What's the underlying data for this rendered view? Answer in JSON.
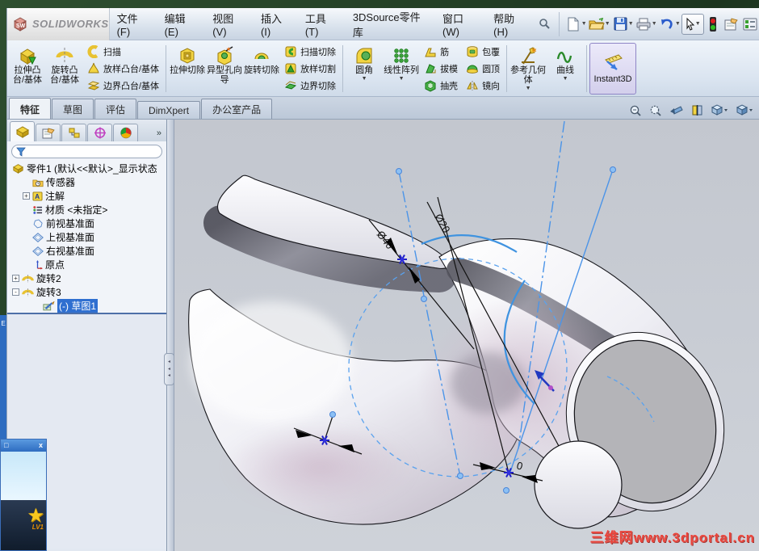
{
  "colors": {
    "selection": "#2f6fd0",
    "sketch_blue": "#4b94e8",
    "watermark_red": "#e8433a",
    "ribbon_bg": "#dae4f0"
  },
  "logo": {
    "text": "SOLIDWORKS"
  },
  "menu": {
    "items": [
      "文件(F)",
      "编辑(E)",
      "视图(V)",
      "插入(I)",
      "工具(T)",
      "3DSource零件库",
      "窗口(W)",
      "帮助(H)"
    ]
  },
  "ribbon": {
    "groups": [
      {
        "big": [
          "拉伸凸台/基体",
          "旋转凸台/基体"
        ],
        "small": [
          "扫描",
          "放样凸台/基体",
          "边界凸台/基体"
        ]
      },
      {
        "big": [
          "拉伸切除",
          "异型孔向导",
          "旋转切除"
        ],
        "small": [
          "扫描切除",
          "放样切割",
          "边界切除"
        ]
      },
      {
        "big": [
          "圆角",
          "线性阵列"
        ],
        "small": [
          "筋",
          "拔模",
          "抽壳"
        ],
        "small2": [
          "包覆",
          "圆顶",
          "镜向"
        ]
      },
      {
        "big": [
          "参考几何体",
          "曲线"
        ]
      },
      {
        "big": [
          "Instant3D"
        ]
      }
    ]
  },
  "tabs": {
    "items": [
      "特征",
      "草图",
      "评估",
      "DimXpert",
      "办公室产品"
    ],
    "active": "特征"
  },
  "feature_tree": {
    "title": "零件1  (默认<<默认>_显示状态",
    "items": [
      {
        "label": "传感器"
      },
      {
        "label": "注解",
        "expand": "+"
      },
      {
        "label": "材质 <未指定>"
      },
      {
        "label": "前视基准面"
      },
      {
        "label": "上视基准面"
      },
      {
        "label": "右视基准面"
      },
      {
        "label": "原点"
      },
      {
        "label": "旋转2",
        "expand": "+"
      },
      {
        "label": "旋转3",
        "expand": "-"
      },
      {
        "label": "(-) 草图1",
        "selected": true
      }
    ]
  },
  "viewport": {
    "dims": {
      "d1": "Ø40",
      "d2": "Ø20",
      "d3": "0"
    },
    "watermark": "三维网www.3dportal.cn"
  },
  "panel": {
    "more": "»"
  },
  "qq": {
    "level": "LV1",
    "edge": "E",
    "minimize": "□",
    "close": "x"
  }
}
